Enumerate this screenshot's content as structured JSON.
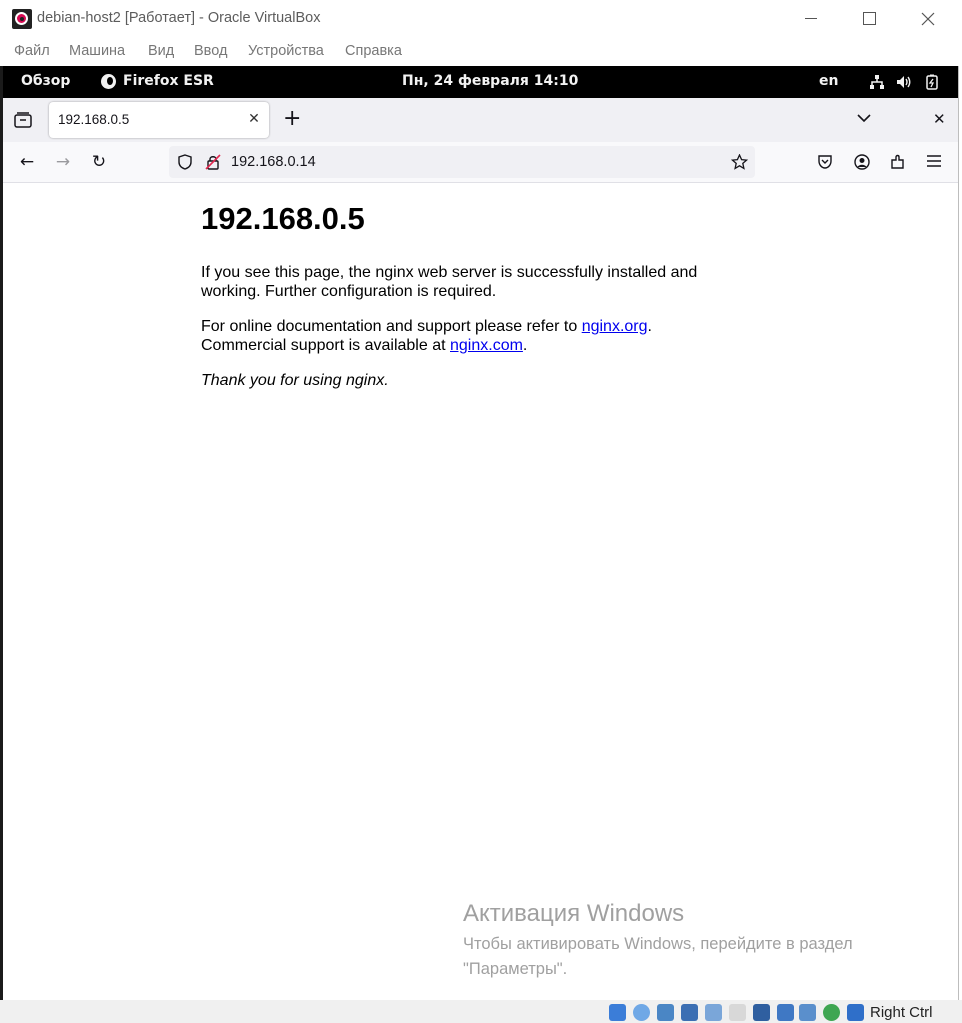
{
  "vbox": {
    "window_title": "debian-host2 [Работает] - Oracle VirtualBox",
    "menu": [
      "Файл",
      "Машина",
      "Вид",
      "Ввод",
      "Устройства",
      "Справка"
    ],
    "host_key": "Right Ctrl"
  },
  "gnome": {
    "activities": "Обзор",
    "app_name": "Firefox ESR",
    "clock": "Пн, 24 февраля  14:10",
    "keyboard_layout": "en"
  },
  "firefox": {
    "tab_title": "192.168.0.5",
    "url": "192.168.0.14"
  },
  "page": {
    "heading": "192.168.0.5",
    "p1": "If you see this page, the nginx web server is successfully installed and working. Further configuration is required.",
    "p2_prefix": "For online documentation and support please refer to ",
    "p2_link1": "nginx.org",
    "p2_mid": ".",
    "p2_line2_prefix": "Commercial support is available at ",
    "p2_link2": "nginx.com",
    "p2_end": ".",
    "p3": "Thank you for using nginx."
  },
  "activation": {
    "title": "Активация Windows",
    "subtitle": "Чтобы активировать Windows, перейдите в раздел \"Параметры\"."
  },
  "colors": {
    "link": "#0000ee",
    "gnome_bar": "#000000",
    "debian_red": "#d70a53"
  }
}
